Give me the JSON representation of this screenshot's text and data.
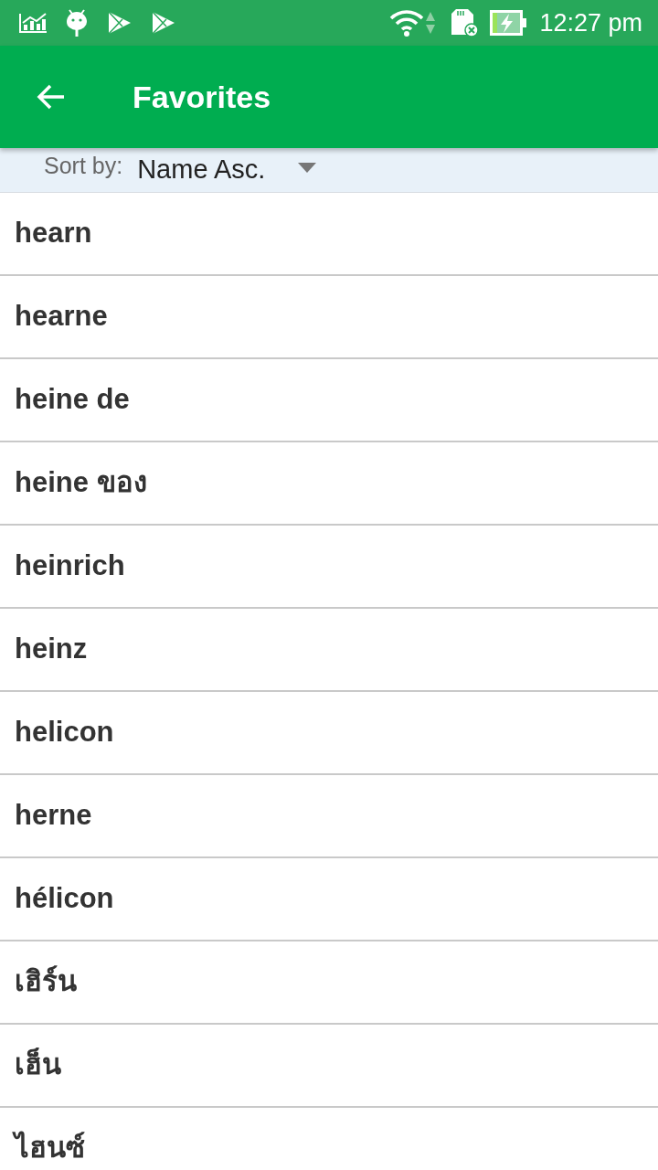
{
  "status_bar": {
    "time": "12:27 pm"
  },
  "app_bar": {
    "title": "Favorites"
  },
  "sort": {
    "label": "Sort by:",
    "value": "Name Asc."
  },
  "items": [
    "hearn",
    "hearne",
    "heine de",
    "heine ของ",
    "heinrich",
    "heinz",
    "helicon",
    "herne",
    "hélicon",
    "เฮิร์น",
    "เฮ็น",
    "ไฮนซ์"
  ]
}
